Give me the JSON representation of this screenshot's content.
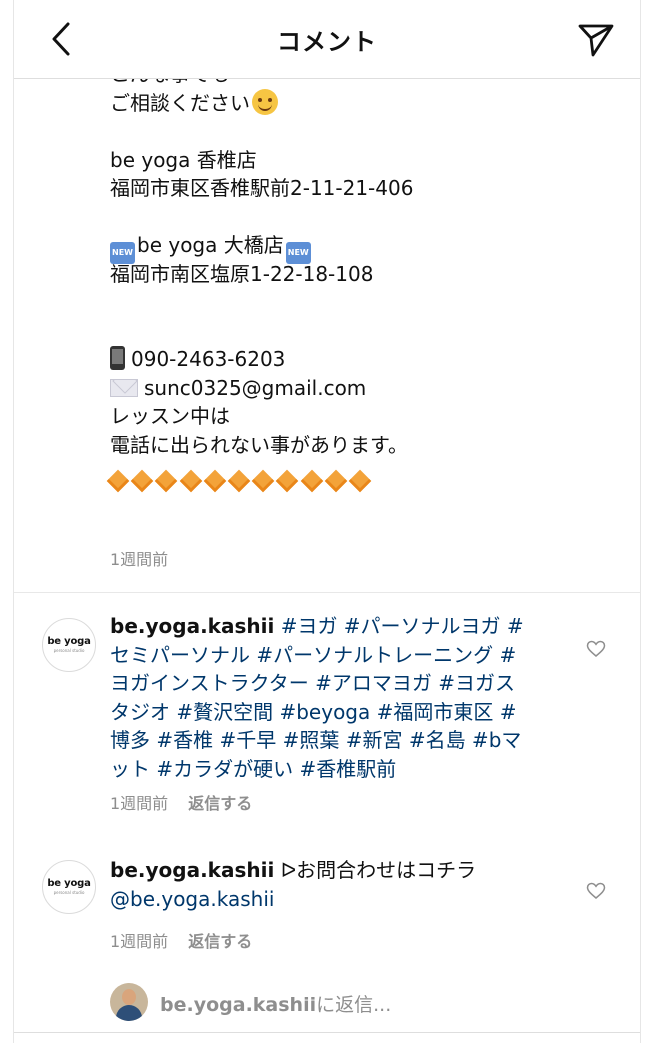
{
  "header": {
    "title": "コメント"
  },
  "caption": {
    "partial_line": "こんな事でも",
    "lines": [
      "ご相談ください",
      "",
      "be yoga 香椎店",
      "福岡市東区香椎駅前2-11-21-406",
      "",
      "be yoga 大橋店",
      "福岡市南区塩原1-22-18-108",
      "",
      "",
      "090-2463-6203",
      "sunc0325@gmail.com",
      "レッスン中は",
      "電話に出られない事があります。"
    ],
    "new_badge": "NEW",
    "diamond_count": 11,
    "time": "1週間前"
  },
  "comments": [
    {
      "avatar_text": "be yoga",
      "avatar_sub": "personal studio",
      "username": "be.yoga.kashii",
      "lines": [
        "#ヨガ #パーソナルヨガ #",
        "セミパーソナル #パーソナルトレーニング #",
        "ヨガインストラクター #アロマヨガ #ヨガス",
        "タジオ #贅沢空間 #beyoga #福岡市東区 #",
        "博多 #香椎 #千早 #照葉 #新宮 #名島 #bマ",
        "ット #カラダが硬い #香椎駅前"
      ],
      "time": "1週間前",
      "reply_label": "返信する"
    },
    {
      "avatar_text": "be yoga",
      "avatar_sub": "personal studio",
      "username": "be.yoga.kashii",
      "text": "ᐅお問合わせはコチラ",
      "mention": "@be.yoga.kashii",
      "time": "1週間前",
      "reply_label": "返信する"
    }
  ],
  "reply_box": {
    "username": "be.yoga.kashii",
    "suffix": "に返信..."
  }
}
